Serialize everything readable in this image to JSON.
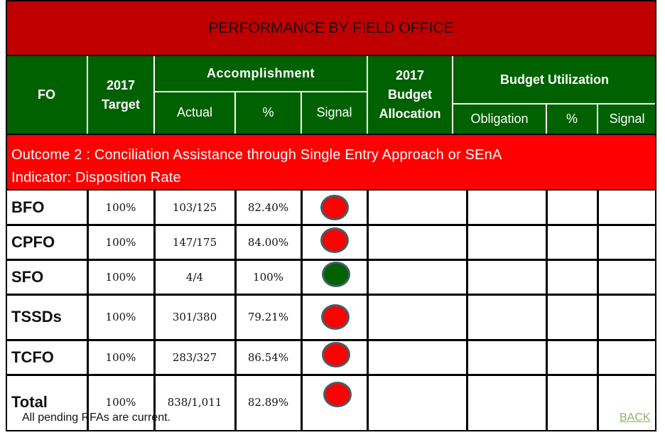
{
  "title": "PERFORMANCE BY FIELD OFFICE",
  "header": {
    "fo": "FO",
    "target": "2017 Target",
    "accomplishment": "Accomplishment",
    "actual": "Actual",
    "percent": "%",
    "signal": "Signal",
    "budget_allocation": "2017 Budget Allocation",
    "budget_utilization": "Budget Utilization",
    "obligation": "Obligation",
    "budget_percent": "%",
    "budget_signal": "Signal"
  },
  "banner": {
    "outcome": "Outcome 2 : Conciliation Assistance through Single Entry Approach or SEnA",
    "indicator": "Indicator: Disposition Rate"
  },
  "colors": {
    "title_bg": "#c00000",
    "header_bg": "#006100",
    "banner_bg": "#ff0000",
    "signal_red": "#ff0000",
    "signal_green": "#006100"
  },
  "rows": [
    {
      "fo": "BFO",
      "target": "100%",
      "actual": "103/125",
      "percent": "82.40%",
      "signal": "red"
    },
    {
      "fo": "CPFO",
      "target": "100%",
      "actual": "147/175",
      "percent": "84.00%",
      "signal": "red"
    },
    {
      "fo": "SFO",
      "target": "100%",
      "actual": "4/4",
      "percent": "100%",
      "signal": "green"
    },
    {
      "fo": "TSSDs",
      "target": "100%",
      "actual": "301/380",
      "percent": "79.21%",
      "signal": "red"
    },
    {
      "fo": "TCFO",
      "target": "100%",
      "actual": "283/327",
      "percent": "86.54%",
      "signal": "red"
    },
    {
      "fo": "Total",
      "target": "100%",
      "actual": "838/1,011",
      "percent": "82.89%",
      "signal": "red"
    }
  ],
  "footer": {
    "note": "All pending RFAs are current.",
    "back_link": "BACK"
  }
}
